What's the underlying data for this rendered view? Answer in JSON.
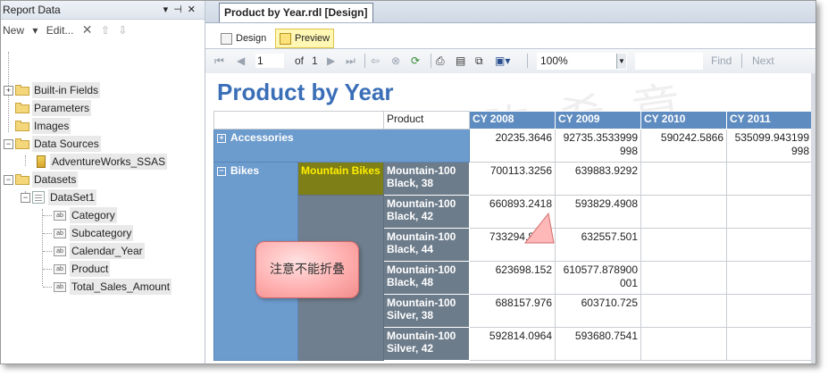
{
  "left_panel": {
    "title": "Report Data",
    "toolbar": {
      "new": "New",
      "edit": "Edit...",
      "delete_glyph": "✕",
      "up_glyph": "⇧",
      "down_glyph": "⇩"
    },
    "tree": {
      "builtin_fields": "Built-in Fields",
      "parameters": "Parameters",
      "images": "Images",
      "data_sources": "Data Sources",
      "data_source_1": "AdventureWorks_SSAS",
      "datasets": "Datasets",
      "dataset_1": "DataSet1",
      "fields": [
        "Category",
        "Subcategory",
        "Calendar_Year",
        "Product",
        "Total_Sales_Amount"
      ]
    }
  },
  "document": {
    "tab_label": "Product by Year.rdl [Design]",
    "view_tabs": {
      "design": "Design",
      "preview": "Preview"
    },
    "toolbar": {
      "page_current": "1",
      "of_label": "of",
      "page_total": "1",
      "zoom": "100%",
      "find": "Find",
      "next": "Next"
    }
  },
  "report": {
    "title": "Product by Year",
    "product_header": "Product",
    "years": [
      "CY 2008",
      "CY 2009",
      "CY 2010",
      "CY 2011"
    ],
    "categories": {
      "accessories": {
        "label": "Accessories",
        "values": [
          "20235.3646",
          "92735.3533999998",
          "590242.5866",
          "535099.943199998"
        ]
      },
      "bikes": {
        "label": "Bikes",
        "subcategory": "Mountain Bikes",
        "products": [
          {
            "name": "Mountain-100 Black, 38",
            "values": [
              "700113.3256",
              "639883.9292"
            ]
          },
          {
            "name": "Mountain-100 Black, 42",
            "values": [
              "660893.2418",
              "593829.4908"
            ]
          },
          {
            "name": "Mountain-100 Black, 44",
            "values": [
              "733294.8773",
              "632557.501"
            ]
          },
          {
            "name": "Mountain-100 Black, 48",
            "values": [
              "623698.152",
              "610577.878900001"
            ]
          },
          {
            "name": "Mountain-100 Silver, 38",
            "values": [
              "688157.976",
              "603710.725"
            ]
          },
          {
            "name": "Mountain-100 Silver, 42",
            "values": [
              "592814.0964",
              "593680.7541"
            ]
          }
        ]
      }
    },
    "callout_text": "注意不能折叠",
    "watermark_text": "陈希章"
  },
  "colors": {
    "title_blue": "#3a6fb8",
    "header_blue": "#5f8cc0",
    "category_blue": "#6c9bcd",
    "subcategory_highlight": "#7f7f18",
    "callout_pink": "#ffb0b0"
  }
}
